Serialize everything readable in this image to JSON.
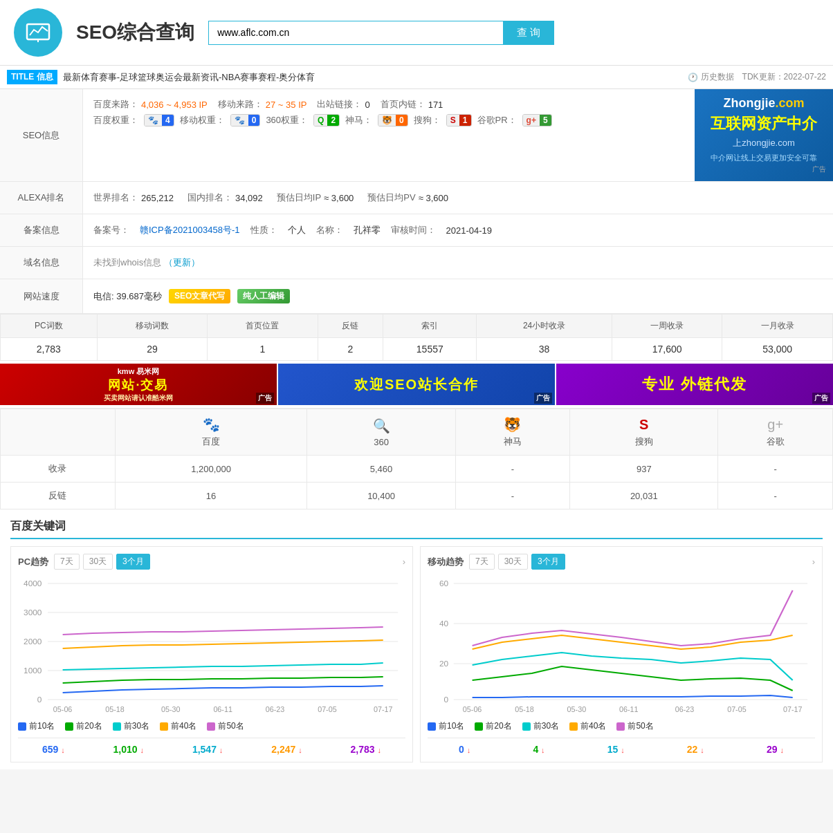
{
  "header": {
    "title": "SEO综合查询",
    "search_placeholder": "www.aflc.com.cn",
    "search_btn": "查 询"
  },
  "title_bar": {
    "badge": "TITLE 信息",
    "title_text": "最新体育赛事-足球篮球奥运会最新资讯-NBA赛事赛程-奥分体育",
    "history_btn": "历史数据",
    "tdk_update": "TDK更新：2022-07-22"
  },
  "seo_info": {
    "label": "SEO信息",
    "baidu_traffic": "4,036 ~ 4,953 IP",
    "mobile_traffic": "27 ~ 35 IP",
    "outbound_links": "0",
    "homepage_links": "171",
    "baidu_weight": "4",
    "mobile_weight": "0",
    "weight_360": "2",
    "shenma": "0",
    "sougou": "1",
    "google_pr": "5"
  },
  "alexa": {
    "label": "ALEXA排名",
    "world_rank": "265,212",
    "china_rank": "34,092",
    "daily_ip": "≈ 3,600",
    "daily_pv": "≈ 3,600"
  },
  "beian": {
    "label": "备案信息",
    "beian_no": "赣ICP备2021003458号-1",
    "nature": "个人",
    "name": "孔祥零",
    "audit_time": "2021-04-19"
  },
  "domain": {
    "label": "域名信息",
    "text": "未找到whois信息",
    "update_link": "（更新）"
  },
  "speed": {
    "label": "网站速度",
    "value": "电信: 39.687毫秒",
    "badge1": "SEO文章代写",
    "badge2": "纯人工编辑"
  },
  "stats": {
    "headers": [
      "PC词数",
      "移动词数",
      "首页位置",
      "反链",
      "索引",
      "24小时收录",
      "一周收录",
      "一月收录"
    ],
    "values": [
      "2,783",
      "29",
      "1",
      "2",
      "15557",
      "38",
      "17,600",
      "53,000"
    ]
  },
  "ads": [
    {
      "text": "网站交易",
      "sub": "买卖网站请认准酷米网",
      "tag": "广告",
      "brand": "kmw 易米网"
    },
    {
      "text": "欢迎SEO站长合作",
      "tag": "广告"
    },
    {
      "text": "专业 外链代发",
      "tag": "广告"
    }
  ],
  "index_table": {
    "row_labels": [
      "收录",
      "反链"
    ],
    "engines": [
      "百度",
      "360",
      "神马",
      "搜狗",
      "谷歌"
    ],
    "data": {
      "baidu": [
        "1,200,000",
        "16"
      ],
      "360": [
        "5,460",
        "10,400"
      ],
      "shenma": [
        "-",
        "-"
      ],
      "sougou": [
        "937",
        "20,031"
      ],
      "google": [
        "-",
        "-"
      ]
    }
  },
  "charts": {
    "pc_title": "PC趋势",
    "mobile_title": "移动趋势",
    "tabs": [
      "7天",
      "30天",
      "3个月"
    ],
    "active_tab": "3个月",
    "x_labels_pc": [
      "05-06",
      "05-18",
      "05-30",
      "06-11",
      "06-23",
      "07-05",
      "07-17"
    ],
    "x_labels_mobile": [
      "05-06",
      "05-18",
      "05-30",
      "06-11",
      "06-23",
      "07-05",
      "07-17"
    ],
    "y_labels_pc": [
      "4000",
      "3000",
      "2000",
      "1000",
      "0"
    ],
    "y_labels_mobile": [
      "60",
      "40",
      "20",
      "0"
    ],
    "legends": [
      "前10名",
      "前20名",
      "前30名",
      "前40名",
      "前50名"
    ],
    "legend_colors": [
      "#2468f2",
      "#00aa00",
      "#00cccc",
      "#ffaa00",
      "#cc66cc"
    ]
  },
  "keyword_stats_pc": {
    "values": [
      "659↓",
      "1,010↓",
      "1,547↓",
      "2,247↓",
      "2,783↓"
    ],
    "colors": [
      "blue",
      "green",
      "cyan",
      "orange",
      "purple"
    ]
  },
  "keyword_stats_mobile": {
    "values": [
      "0↓",
      "4↓",
      "15↓",
      "22↓",
      "29↓"
    ],
    "colors": [
      "blue",
      "green",
      "cyan",
      "orange",
      "purple"
    ]
  }
}
